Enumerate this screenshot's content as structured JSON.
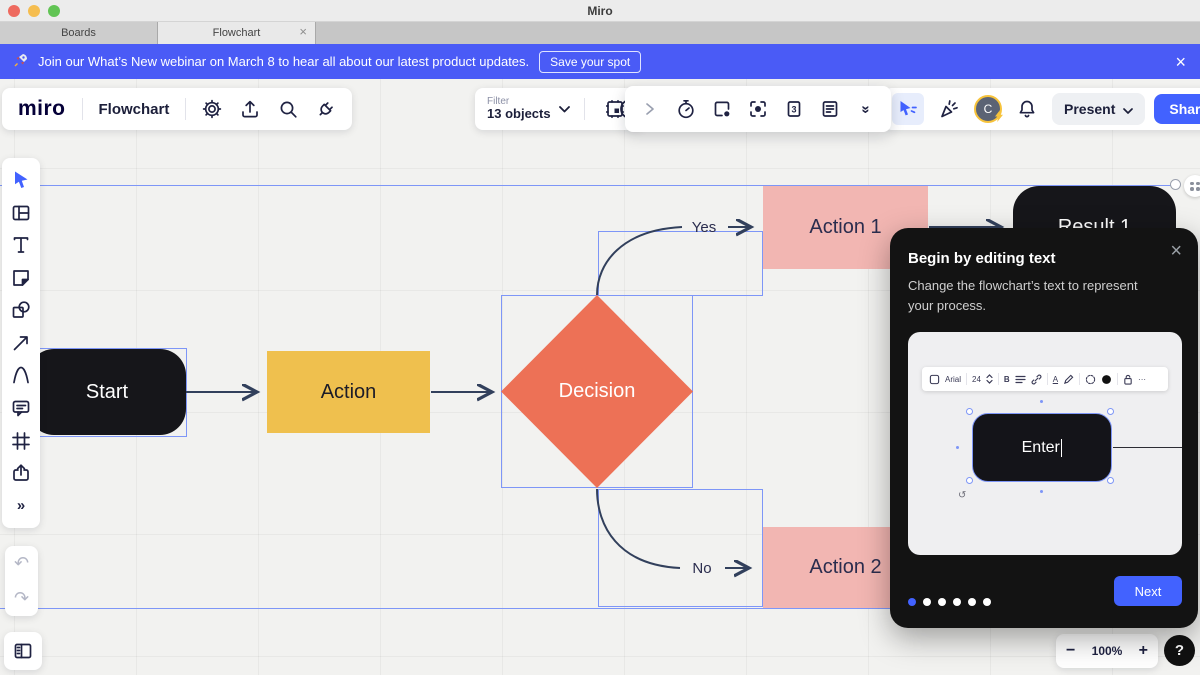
{
  "window": {
    "title": "Miro",
    "tabs": [
      {
        "label": "Boards"
      },
      {
        "label": "Flowchart"
      }
    ],
    "tab_close": "×"
  },
  "banner": {
    "icon": "rocket-icon",
    "text": "Join our What’s New webinar on March 8 to hear all about our latest product updates.",
    "cta": "Save your spot",
    "close": "×",
    "bg": "#4a5bf6"
  },
  "header": {
    "logo": "miro",
    "board_name": "Flowchart",
    "icons": [
      "settings-icon",
      "export-icon",
      "search-icon",
      "integrations-icon"
    ]
  },
  "filter": {
    "label": "Filter",
    "value": "13 objects"
  },
  "tools_overlay": {
    "icons": [
      "chevron-right-icon",
      "timer-icon",
      "export-frame-icon",
      "focus-icon",
      "slides-icon",
      "notes-icon",
      "collapse-icon"
    ],
    "slides_number": "3",
    "collapse_glyph": "»"
  },
  "collab": {
    "icons": [
      "pointer-icon",
      "reactions-icon",
      "notifications-icon"
    ],
    "avatar_initial": "C",
    "present_label": "Present",
    "share_label": "Share"
  },
  "sidebar": {
    "tools": [
      "select",
      "templates",
      "text",
      "sticky-note",
      "shapes",
      "connection-line",
      "pen",
      "comment",
      "frame",
      "upload",
      "more"
    ],
    "more_glyph": "»",
    "undo_glyph": "↶",
    "redo_glyph": "↷"
  },
  "canvas": {
    "nodes": {
      "start": "Start",
      "action": "Action",
      "decision": "Decision",
      "action1": "Action 1",
      "action2": "Action 2",
      "result1": "Result 1"
    },
    "connector_labels": {
      "yes": "Yes",
      "no": "No"
    }
  },
  "popup": {
    "title": "Begin by editing text",
    "body": "Change the flowchart’s text to represent your process.",
    "close": "×",
    "toolbar": {
      "font": "Arial",
      "size": "24",
      "bold": "B",
      "color_letter": "A",
      "more": "···"
    },
    "node_text": "Enter",
    "dots_total": 6,
    "active_dot": 1,
    "next_label": "Next"
  },
  "zoom_bar": {
    "minus": "−",
    "level": "100%",
    "plus": "+",
    "help": "?"
  },
  "colors": {
    "accent": "#4262ff",
    "banner": "#4a5bf6",
    "selection": "#7e96f7",
    "node_dark": "#16161a",
    "node_yellow": "#efc04e",
    "node_orange": "#ed7156",
    "node_pink": "#f2b6b2",
    "arrow": "#32405c"
  }
}
